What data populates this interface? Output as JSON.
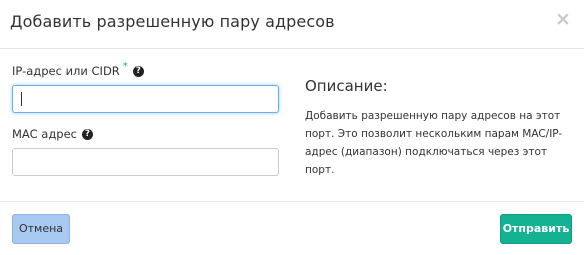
{
  "dialog": {
    "title": "Добавить разрешенную пару адресов",
    "close_symbol": "×"
  },
  "form": {
    "ip_field": {
      "label": "IP-адрес или CIDR",
      "required_mark": "*",
      "help_icon": "question-circle-icon",
      "value": "",
      "focused": true
    },
    "mac_field": {
      "label": "MAC адрес",
      "help_icon": "question-circle-icon",
      "value": ""
    }
  },
  "description": {
    "title": "Описание:",
    "text": "Добавить разрешенную пару адресов на этот порт. Это позволит нескольким парам MAC/IP-адрес (диапазон) подключаться через этот порт."
  },
  "footer": {
    "cancel_label": "Отмена",
    "submit_label": "Отправить"
  },
  "colors": {
    "accent": "#12b293",
    "cancel_bg": "#a6c8f1",
    "focus_border": "#66afe9",
    "required_star": "#0ead8f"
  }
}
